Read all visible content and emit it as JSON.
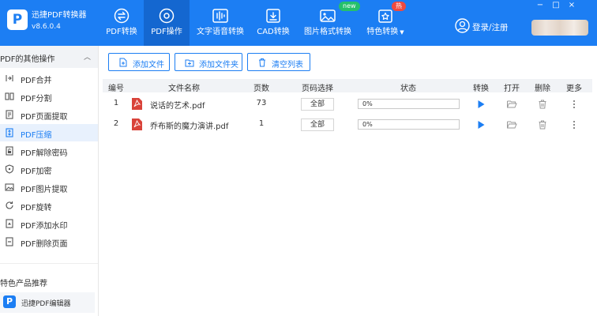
{
  "app": {
    "name": "迅捷PDF转换器",
    "version": "v8.6.0.4",
    "logo_letter": "P"
  },
  "nav": [
    {
      "label": "PDF转换",
      "icon": "swap-circle-icon",
      "active": false
    },
    {
      "label": "PDF操作",
      "icon": "gear-icon",
      "active": true
    },
    {
      "label": "文字语音转换",
      "icon": "audio-wave-icon",
      "active": false
    },
    {
      "label": "CAD转换",
      "icon": "cad-download-icon",
      "active": false
    },
    {
      "label": "图片格式转换",
      "icon": "image-icon",
      "active": false,
      "badge": "new"
    },
    {
      "label": "特色转换",
      "icon": "star-box-icon",
      "active": false,
      "badge": "热",
      "dropdown": true
    }
  ],
  "account": {
    "login_label": "登录/注册"
  },
  "window_controls": [
    "−",
    "□",
    "×"
  ],
  "sidebar": {
    "section_title": "PDF的其他操作",
    "items": [
      {
        "label": "PDF合并",
        "icon": "merge-icon"
      },
      {
        "label": "PDF分割",
        "icon": "split-icon"
      },
      {
        "label": "PDF页面提取",
        "icon": "page-extract-icon"
      },
      {
        "label": "PDF压缩",
        "icon": "compress-icon",
        "active": true
      },
      {
        "label": "PDF解除密码",
        "icon": "unlock-icon"
      },
      {
        "label": "PDF加密",
        "icon": "shield-icon"
      },
      {
        "label": "PDF图片提取",
        "icon": "image-extract-icon"
      },
      {
        "label": "PDF旋转",
        "icon": "rotate-icon"
      },
      {
        "label": "PDF添加水印",
        "icon": "watermark-icon"
      },
      {
        "label": "PDF删除页面",
        "icon": "delete-page-icon"
      }
    ],
    "recommend_title": "特色产品推荐",
    "recommend_item": "迅捷PDF编辑器"
  },
  "toolbar": {
    "add_file": "添加文件",
    "add_folder": "添加文件夹",
    "clear_list": "清空列表"
  },
  "table": {
    "headers": [
      "编号",
      "文件名称",
      "页数",
      "页码选择",
      "状态",
      "转换",
      "打开",
      "删除",
      "更多"
    ],
    "rows": [
      {
        "index": "1",
        "name": "说话的艺术.pdf",
        "pages": "73",
        "page_select": "全部",
        "progress_text": "0%",
        "progress": 0
      },
      {
        "index": "2",
        "name": "乔布斯的魔力演讲.pdf",
        "pages": "1",
        "page_select": "全部",
        "progress_text": "0%",
        "progress": 0
      }
    ]
  },
  "colors": {
    "accent": "#1c7ef3",
    "accent_dark": "#1467d0",
    "pdf_red": "#d9433a",
    "badge_new": "#25c06b",
    "badge_hot": "#ef4a3f"
  }
}
